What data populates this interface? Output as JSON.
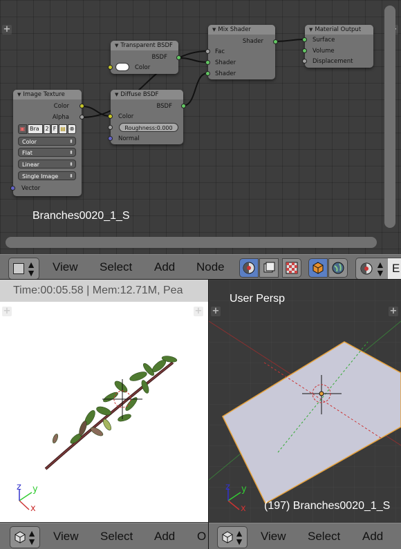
{
  "node_editor": {
    "material_label": "Branches0020_1_S",
    "nodes": {
      "transparent_bsdf": {
        "title": "Transparent BSDF",
        "out_bsdf": "BSDF",
        "in_color": "Color"
      },
      "mix_shader": {
        "title": "Mix Shader",
        "out_shader": "Shader",
        "in_fac": "Fac",
        "in_shader1": "Shader",
        "in_shader2": "Shader"
      },
      "material_output": {
        "title": "Material Output",
        "in_surface": "Surface",
        "in_volume": "Volume",
        "in_displacement": "Displacement"
      },
      "image_texture": {
        "title": "Image Texture",
        "out_color": "Color",
        "out_alpha": "Alpha",
        "image_name": "Bra",
        "users": "2",
        "fake_user": "F",
        "color_space": "Color",
        "projection": "Flat",
        "interpolation": "Linear",
        "source": "Single Image",
        "in_vector": "Vector"
      },
      "diffuse_bsdf": {
        "title": "Diffuse BSDF",
        "out_bsdf": "BSDF",
        "in_color": "Color",
        "roughness": "Roughness:0.000",
        "in_normal": "Normal"
      }
    }
  },
  "node_header": {
    "menu": [
      "View",
      "Select",
      "Add",
      "Node"
    ],
    "cut_label": "E"
  },
  "image_editor": {
    "info": "Time:00:05.58 | Mem:12.71M, Pea",
    "axis_x": "x",
    "axis_y": "y",
    "axis_z": "z"
  },
  "image_header": {
    "menu": [
      "View",
      "Select",
      "Add",
      "O"
    ]
  },
  "viewport": {
    "view_name": "User Persp",
    "object_info": "(197) Branches0020_1_S",
    "axis_x": "x",
    "axis_y": "y",
    "axis_z": "z"
  },
  "viewport_header": {
    "menu": [
      "View",
      "Select",
      "Add"
    ]
  },
  "colors": {
    "socket_color": "#c7c729",
    "socket_shader": "#63c763",
    "socket_value": "#a1a1a1",
    "socket_vector": "#6363c7",
    "selection": "#e8a33c",
    "plane": "#c9c9d8"
  },
  "icons": [
    "editor-type-icon",
    "solid-material-icon",
    "texture-icon",
    "checker-icon",
    "cube-icon",
    "world-icon",
    "add-icon",
    "cursor-icon",
    "plus-icon"
  ]
}
